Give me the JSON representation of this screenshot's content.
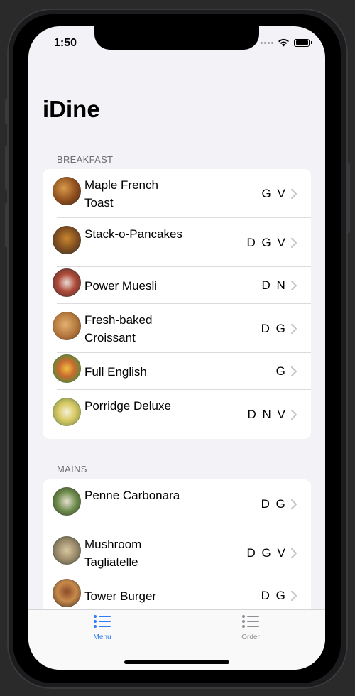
{
  "status": {
    "time": "1:50"
  },
  "nav": {
    "title": "iDine"
  },
  "sections": [
    {
      "header": "BREAKFAST",
      "items": [
        {
          "name": "Maple French Toast",
          "tags": "G V",
          "icon": "food-thumb-maple-french-toast"
        },
        {
          "name": "Stack-o-Pancakes",
          "tags": "D G V",
          "icon": "food-thumb-stack-o-pancakes"
        },
        {
          "name": "Power Muesli",
          "tags": "D N",
          "icon": "food-thumb-power-muesli"
        },
        {
          "name": "Fresh-baked Croissant",
          "tags": "D G",
          "icon": "food-thumb-croissant"
        },
        {
          "name": "Full English",
          "tags": "G",
          "icon": "food-thumb-full-english"
        },
        {
          "name": "Porridge Deluxe",
          "tags": "D N V",
          "icon": "food-thumb-porridge"
        }
      ]
    },
    {
      "header": "MAINS",
      "items": [
        {
          "name": "Penne Carbonara",
          "tags": "D G",
          "icon": "food-thumb-penne"
        },
        {
          "name": "Mushroom Tagliatelle",
          "tags": "D G V",
          "icon": "food-thumb-tagliatelle"
        },
        {
          "name": "Tower Burger",
          "tags": "D G",
          "icon": "food-thumb-burger"
        }
      ]
    }
  ],
  "tabbar": {
    "menu_label": "Menu",
    "order_label": "Order",
    "active_color": "#2f7cf6",
    "inactive_color": "#8e8e93"
  },
  "colors": {
    "background": "#f2f2f7",
    "card": "#ffffff",
    "chevron": "#c4c4c8"
  }
}
